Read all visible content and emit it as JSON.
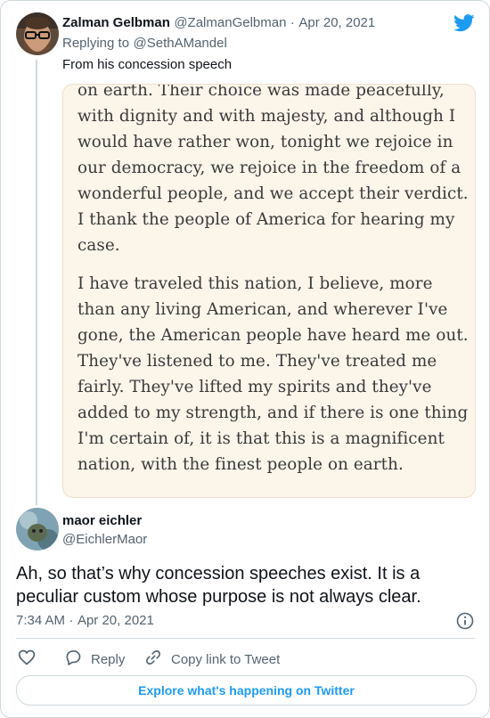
{
  "reply_tweet": {
    "author_name": "Zalman Gelbman",
    "author_handle": "@ZalmanGelbman",
    "separator": "·",
    "date": "Apr 20, 2021",
    "replying_to_prefix": "Replying to",
    "replying_to_handle": "@SethAMandel",
    "text": "From his concession speech",
    "image_paragraphs": [
      "on earth. Their choice was made peacefully, with dignity and with majesty, and although I would have rather won, tonight we rejoice in our democracy, we rejoice in the freedom of a wonderful people, and we accept their verdict. I thank the people of America for hearing my case.",
      "I have traveled this nation, I believe, more than any living American, and wherever I've gone, the American people have heard me out. They've listened to me. They've treated me fairly. They've lifted my spirits and they've added to my strength, and if there is one thing I'm certain of, it is that this is a magnificent nation, with the finest people on earth."
    ]
  },
  "main_tweet": {
    "author_name": "maor eichler",
    "author_handle": "@EichlerMaor",
    "text": "Ah, so that’s why concession speeches exist. It is a peculiar custom whose purpose is not always clear.",
    "time": "7:34 AM",
    "separator": "·",
    "date": "Apr 20, 2021"
  },
  "actions": {
    "reply_label": "Reply",
    "copy_link_label": "Copy link to Tweet"
  },
  "footer": {
    "explore_label": "Explore what's happening on Twitter"
  },
  "colors": {
    "accent": "#1d9bf0",
    "muted": "#536471",
    "border": "#cfd9de"
  }
}
